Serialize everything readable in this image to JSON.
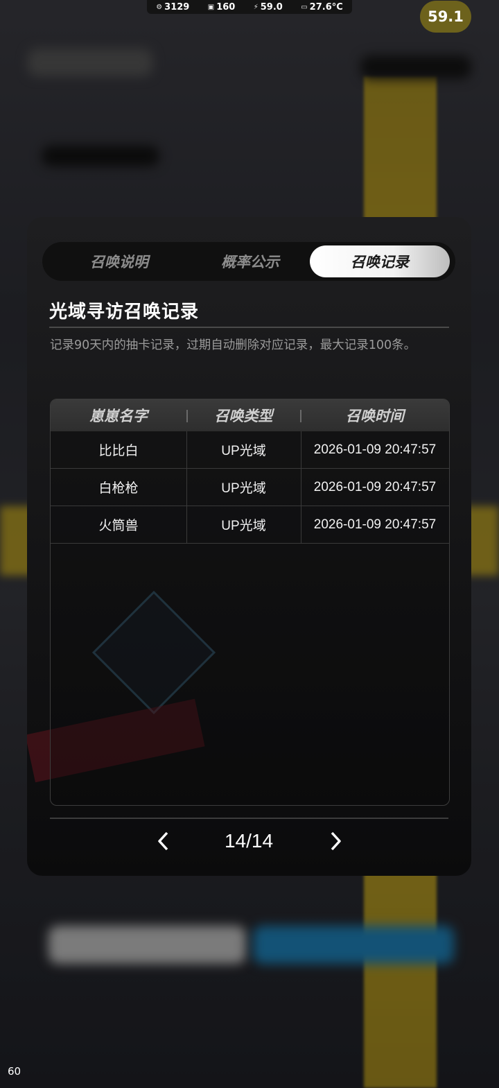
{
  "status_bar": {
    "cpu_freq": "3129",
    "gpu_freq": "160",
    "power": "59.0",
    "temp": "27.6°C"
  },
  "fps_badge": "59.1",
  "corner_number": "60",
  "tabs": [
    {
      "label": "召唤说明",
      "active": false
    },
    {
      "label": "概率公示",
      "active": false
    },
    {
      "label": "召唤记录",
      "active": true
    }
  ],
  "record": {
    "title": "光域寻访召唤记录",
    "description": "记录90天内的抽卡记录，过期自动删除对应记录，最大记录100条。",
    "columns": [
      "崽崽名字",
      "召唤类型",
      "召唤时间"
    ],
    "rows": [
      {
        "name": "比比白",
        "type": "UP光域",
        "time": "2026-01-09 20:47:57"
      },
      {
        "name": "白枪枪",
        "type": "UP光域",
        "time": "2026-01-09 20:47:57"
      },
      {
        "name": "火筒兽",
        "type": "UP光域",
        "time": "2026-01-09 20:47:57"
      }
    ]
  },
  "pager": {
    "text": "14/14",
    "prev_icon": "chevron-left-icon",
    "next_icon": "chevron-right-icon"
  },
  "colors": {
    "accent_yellow": "#c9ab21",
    "fps_badge_bg": "#6d621c",
    "active_tab_bg": "#ffffff"
  }
}
